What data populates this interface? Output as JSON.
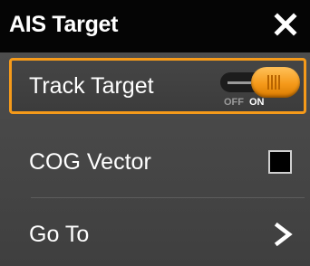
{
  "header": {
    "title": "AIS Target",
    "close_icon": "close-icon"
  },
  "menu": {
    "track_target": {
      "label": "Track Target",
      "toggle_off_label": "OFF",
      "toggle_on_label": "ON",
      "enabled": true
    },
    "cog_vector": {
      "label": "COG Vector",
      "checked": false
    },
    "go_to": {
      "label": "Go To",
      "icon": "chevron-right-icon"
    }
  },
  "colors": {
    "accent": "#f59a1a",
    "header_bg": "#050505",
    "panel_bg": "#4a4a4a"
  }
}
